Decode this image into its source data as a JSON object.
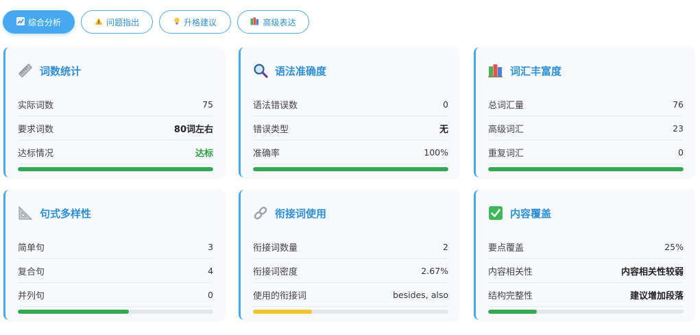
{
  "tabs": [
    {
      "label": "综合分析",
      "icon": "chart-icon",
      "active": true
    },
    {
      "label": "问题指出",
      "icon": "warning-icon",
      "active": false
    },
    {
      "label": "升格建议",
      "icon": "lightbulb-icon",
      "active": false
    },
    {
      "label": "高级表达",
      "icon": "books-icon",
      "active": false
    }
  ],
  "cards": {
    "word_count": {
      "title": "词数统计",
      "icon": "ruler-icon",
      "rows": [
        {
          "label": "实际词数",
          "value": "75"
        },
        {
          "label": "要求词数",
          "value": "80词左右"
        },
        {
          "label": "达标情况",
          "value": "达标"
        }
      ],
      "progress": 1.0,
      "bar_color": "#34a853"
    },
    "grammar": {
      "title": "语法准确度",
      "icon": "magnifier-icon",
      "rows": [
        {
          "label": "语法错误数",
          "value": "0"
        },
        {
          "label": "错误类型",
          "value": "无"
        },
        {
          "label": "准确率",
          "value": "100%"
        }
      ],
      "progress": 1.0,
      "bar_color": "#34a853"
    },
    "vocabulary": {
      "title": "词汇丰富度",
      "icon": "books-icon",
      "rows": [
        {
          "label": "总词汇量",
          "value": "76"
        },
        {
          "label": "高级词汇",
          "value": "23"
        },
        {
          "label": "重复词汇",
          "value": "0"
        }
      ],
      "progress": 1.0,
      "bar_color": "#34a853"
    },
    "sentence": {
      "title": "句式多样性",
      "icon": "triangle-ruler-icon",
      "rows": [
        {
          "label": "简单句",
          "value": "3"
        },
        {
          "label": "复合句",
          "value": "4"
        },
        {
          "label": "并列句",
          "value": "0"
        }
      ],
      "progress": 0.57,
      "bar_color": "#34a853"
    },
    "cohesion": {
      "title": "衔接词使用",
      "icon": "link-icon",
      "rows": [
        {
          "label": "衔接词数量",
          "value": "2"
        },
        {
          "label": "衔接词密度",
          "value": "2.67%"
        },
        {
          "label": "使用的衔接词",
          "value": "besides, also"
        }
      ],
      "progress": 0.3,
      "bar_color": "#f2c230"
    },
    "content": {
      "title": "内容覆盖",
      "icon": "checkbox-icon",
      "rows": [
        {
          "label": "要点覆盖",
          "value": "25%"
        },
        {
          "label": "内容相关性",
          "value": "内容相关性较弱"
        },
        {
          "label": "结构完整性",
          "value": "建议增加段落"
        }
      ],
      "progress": 0.25,
      "bar_color": "#34a853"
    }
  }
}
